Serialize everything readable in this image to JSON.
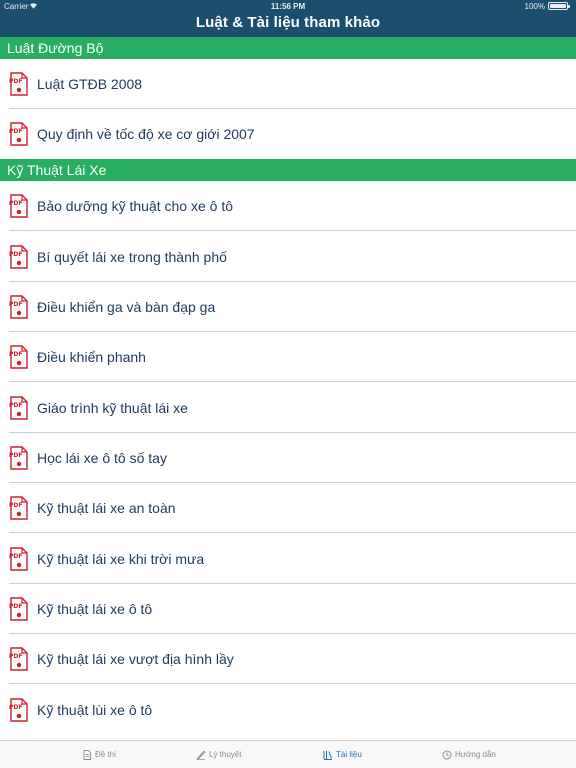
{
  "status_bar": {
    "carrier": "Carrier",
    "time": "11:56 PM",
    "battery": "100%"
  },
  "nav": {
    "title": "Luật & Tài liệu tham khảo"
  },
  "sections": [
    {
      "title": "Luật Đường Bộ",
      "items": [
        {
          "label": "Luật GTĐB 2008",
          "icon": "pdf-icon"
        },
        {
          "label": "Quy định về tốc độ xe cơ giới 2007",
          "icon": "pdf-icon"
        }
      ]
    },
    {
      "title": "Kỹ Thuật Lái Xe",
      "items": [
        {
          "label": "Bảo dưỡng kỹ thuật cho xe ô tô",
          "icon": "pdf-icon"
        },
        {
          "label": "Bí quyết lái xe trong thành phố",
          "icon": "pdf-icon"
        },
        {
          "label": "Điều khiển ga và bàn đạp ga",
          "icon": "pdf-icon"
        },
        {
          "label": "Điều khiển phanh",
          "icon": "pdf-icon"
        },
        {
          "label": "Giáo trình kỹ thuật lái xe",
          "icon": "pdf-icon"
        },
        {
          "label": "Học lái xe ô tô số tay",
          "icon": "pdf-icon"
        },
        {
          "label": "Kỹ thuật lái xe an toàn",
          "icon": "pdf-icon"
        },
        {
          "label": "Kỹ thuật lái xe khi trời mưa",
          "icon": "pdf-icon"
        },
        {
          "label": "Kỹ thuật lái xe ô tô",
          "icon": "pdf-icon"
        },
        {
          "label": "Kỹ thuật lái xe vượt địa hình lầy",
          "icon": "pdf-icon"
        },
        {
          "label": "Kỹ thuật lùi xe ô tô",
          "icon": "pdf-icon"
        }
      ]
    }
  ],
  "tabs": [
    {
      "label": "Đề thi",
      "icon": "document-icon",
      "active": false
    },
    {
      "label": "Lý thuyết",
      "icon": "pencil-icon",
      "active": false
    },
    {
      "label": "Tài liệu",
      "icon": "library-icon",
      "active": true
    },
    {
      "label": "Hướng dẫn",
      "icon": "clock-icon",
      "active": false
    }
  ],
  "colors": {
    "nav_background": "#1c4f6e",
    "section_header": "#27ae60",
    "item_text": "#1f3a5c",
    "pdf_red": "#d0202b",
    "tab_active": "#1f6fb8",
    "tab_inactive": "#8a8a8a"
  }
}
